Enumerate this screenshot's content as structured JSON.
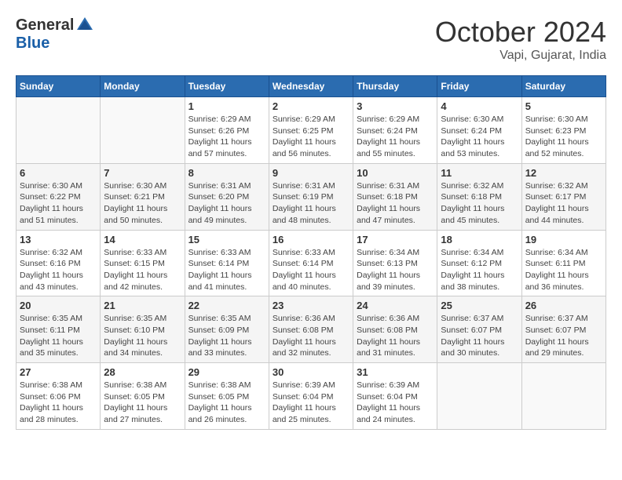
{
  "header": {
    "logo": {
      "general": "General",
      "blue": "Blue"
    },
    "title": "October 2024",
    "location": "Vapi, Gujarat, India"
  },
  "weekdays": [
    "Sunday",
    "Monday",
    "Tuesday",
    "Wednesday",
    "Thursday",
    "Friday",
    "Saturday"
  ],
  "weeks": [
    [
      {
        "day": null,
        "info": null
      },
      {
        "day": null,
        "info": null
      },
      {
        "day": "1",
        "info": "Sunrise: 6:29 AM\nSunset: 6:26 PM\nDaylight: 11 hours and 57 minutes."
      },
      {
        "day": "2",
        "info": "Sunrise: 6:29 AM\nSunset: 6:25 PM\nDaylight: 11 hours and 56 minutes."
      },
      {
        "day": "3",
        "info": "Sunrise: 6:29 AM\nSunset: 6:24 PM\nDaylight: 11 hours and 55 minutes."
      },
      {
        "day": "4",
        "info": "Sunrise: 6:30 AM\nSunset: 6:24 PM\nDaylight: 11 hours and 53 minutes."
      },
      {
        "day": "5",
        "info": "Sunrise: 6:30 AM\nSunset: 6:23 PM\nDaylight: 11 hours and 52 minutes."
      }
    ],
    [
      {
        "day": "6",
        "info": "Sunrise: 6:30 AM\nSunset: 6:22 PM\nDaylight: 11 hours and 51 minutes."
      },
      {
        "day": "7",
        "info": "Sunrise: 6:30 AM\nSunset: 6:21 PM\nDaylight: 11 hours and 50 minutes."
      },
      {
        "day": "8",
        "info": "Sunrise: 6:31 AM\nSunset: 6:20 PM\nDaylight: 11 hours and 49 minutes."
      },
      {
        "day": "9",
        "info": "Sunrise: 6:31 AM\nSunset: 6:19 PM\nDaylight: 11 hours and 48 minutes."
      },
      {
        "day": "10",
        "info": "Sunrise: 6:31 AM\nSunset: 6:18 PM\nDaylight: 11 hours and 47 minutes."
      },
      {
        "day": "11",
        "info": "Sunrise: 6:32 AM\nSunset: 6:18 PM\nDaylight: 11 hours and 45 minutes."
      },
      {
        "day": "12",
        "info": "Sunrise: 6:32 AM\nSunset: 6:17 PM\nDaylight: 11 hours and 44 minutes."
      }
    ],
    [
      {
        "day": "13",
        "info": "Sunrise: 6:32 AM\nSunset: 6:16 PM\nDaylight: 11 hours and 43 minutes."
      },
      {
        "day": "14",
        "info": "Sunrise: 6:33 AM\nSunset: 6:15 PM\nDaylight: 11 hours and 42 minutes."
      },
      {
        "day": "15",
        "info": "Sunrise: 6:33 AM\nSunset: 6:14 PM\nDaylight: 11 hours and 41 minutes."
      },
      {
        "day": "16",
        "info": "Sunrise: 6:33 AM\nSunset: 6:14 PM\nDaylight: 11 hours and 40 minutes."
      },
      {
        "day": "17",
        "info": "Sunrise: 6:34 AM\nSunset: 6:13 PM\nDaylight: 11 hours and 39 minutes."
      },
      {
        "day": "18",
        "info": "Sunrise: 6:34 AM\nSunset: 6:12 PM\nDaylight: 11 hours and 38 minutes."
      },
      {
        "day": "19",
        "info": "Sunrise: 6:34 AM\nSunset: 6:11 PM\nDaylight: 11 hours and 36 minutes."
      }
    ],
    [
      {
        "day": "20",
        "info": "Sunrise: 6:35 AM\nSunset: 6:11 PM\nDaylight: 11 hours and 35 minutes."
      },
      {
        "day": "21",
        "info": "Sunrise: 6:35 AM\nSunset: 6:10 PM\nDaylight: 11 hours and 34 minutes."
      },
      {
        "day": "22",
        "info": "Sunrise: 6:35 AM\nSunset: 6:09 PM\nDaylight: 11 hours and 33 minutes."
      },
      {
        "day": "23",
        "info": "Sunrise: 6:36 AM\nSunset: 6:08 PM\nDaylight: 11 hours and 32 minutes."
      },
      {
        "day": "24",
        "info": "Sunrise: 6:36 AM\nSunset: 6:08 PM\nDaylight: 11 hours and 31 minutes."
      },
      {
        "day": "25",
        "info": "Sunrise: 6:37 AM\nSunset: 6:07 PM\nDaylight: 11 hours and 30 minutes."
      },
      {
        "day": "26",
        "info": "Sunrise: 6:37 AM\nSunset: 6:07 PM\nDaylight: 11 hours and 29 minutes."
      }
    ],
    [
      {
        "day": "27",
        "info": "Sunrise: 6:38 AM\nSunset: 6:06 PM\nDaylight: 11 hours and 28 minutes."
      },
      {
        "day": "28",
        "info": "Sunrise: 6:38 AM\nSunset: 6:05 PM\nDaylight: 11 hours and 27 minutes."
      },
      {
        "day": "29",
        "info": "Sunrise: 6:38 AM\nSunset: 6:05 PM\nDaylight: 11 hours and 26 minutes."
      },
      {
        "day": "30",
        "info": "Sunrise: 6:39 AM\nSunset: 6:04 PM\nDaylight: 11 hours and 25 minutes."
      },
      {
        "day": "31",
        "info": "Sunrise: 6:39 AM\nSunset: 6:04 PM\nDaylight: 11 hours and 24 minutes."
      },
      {
        "day": null,
        "info": null
      },
      {
        "day": null,
        "info": null
      }
    ]
  ]
}
